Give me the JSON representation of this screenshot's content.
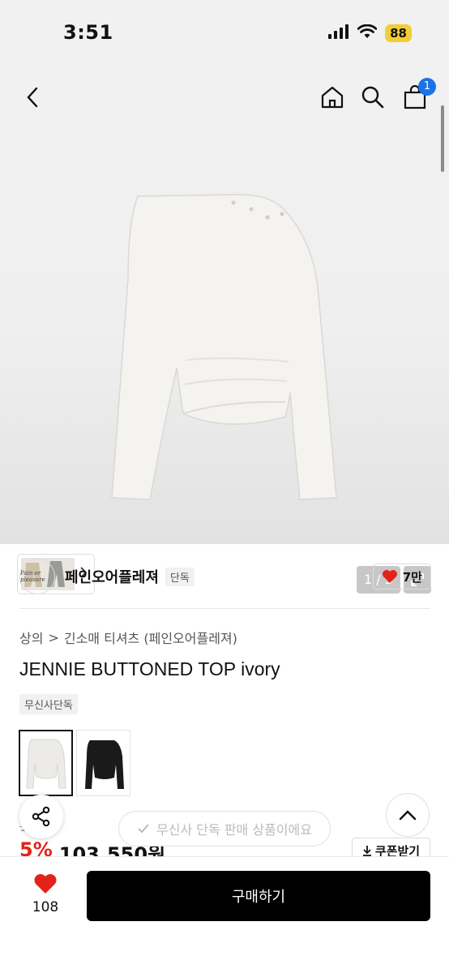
{
  "status_bar": {
    "time": "3:51",
    "battery": "88"
  },
  "top_nav": {
    "cart_count": "1"
  },
  "gallery": {
    "page_indicator": "1 / 3"
  },
  "brand": {
    "name": "페인오어플레져",
    "tag": "단독",
    "logo_text": "Pain or pleasure",
    "likes": "7만"
  },
  "breadcrumb": {
    "category": "상의",
    "separator": ">",
    "subcategory": "긴소매 티셔츠 (페인오어플레져)"
  },
  "product": {
    "title": "JENNIE BUTTONED TOP ivory",
    "badge": "무신사단독"
  },
  "colors": [
    {
      "name": "ivory",
      "swatch": "#ececea"
    },
    {
      "name": "black",
      "swatch": "#1a1a1a"
    }
  ],
  "price": {
    "original": "1  0원",
    "discount": "5%",
    "sale": "103,550원"
  },
  "toast": {
    "text": "무신사 단독 판매 상품이에요"
  },
  "coupon": {
    "label": "쿠폰받기"
  },
  "bottom_bar": {
    "wish_count": "108",
    "buy_label": "구매하기"
  },
  "theme": {
    "accent_red": "#e2231a",
    "badge_blue": "#1a73e8",
    "heart_red": "#e2231a"
  }
}
